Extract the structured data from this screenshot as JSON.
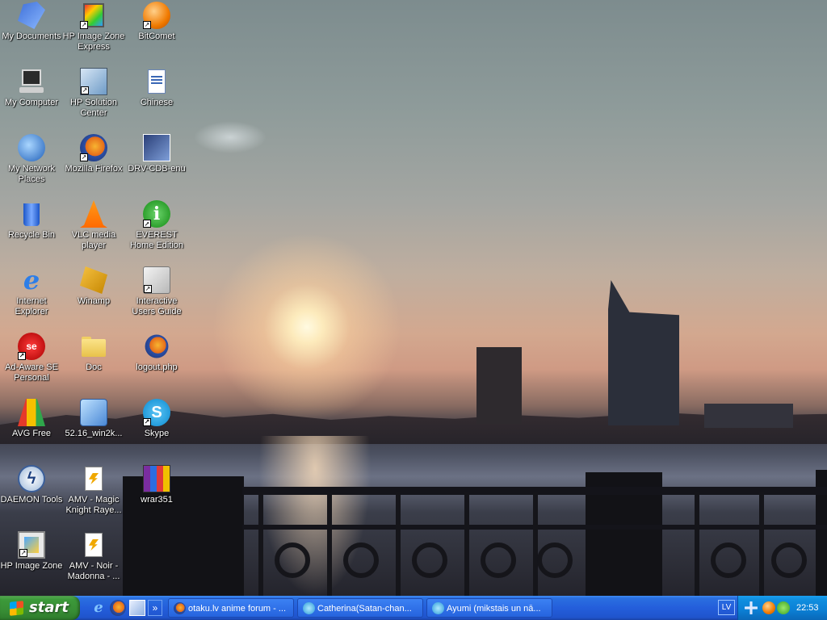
{
  "desktop": {
    "icons": [
      {
        "label": "My Documents"
      },
      {
        "label": "My Computer"
      },
      {
        "label": "My Network Places"
      },
      {
        "label": "Recycle Bin"
      },
      {
        "label": "Internet Explorer"
      },
      {
        "label": "Ad-Aware SE Personal"
      },
      {
        "label": "AVG Free"
      },
      {
        "label": "DAEMON Tools"
      },
      {
        "label": "HP  Image Zone"
      },
      {
        "label": "HP Image Zone Express"
      },
      {
        "label": "HP Solution Center"
      },
      {
        "label": "Mozilla Firefox"
      },
      {
        "label": "VLC media player"
      },
      {
        "label": "Winamp"
      },
      {
        "label": "Doc"
      },
      {
        "label": "52.16_win2k..."
      },
      {
        "label": "AMV - Magic Knight Raye..."
      },
      {
        "label": "AMV - Noir - Madonna - ..."
      },
      {
        "label": "BitComet"
      },
      {
        "label": "Chinese"
      },
      {
        "label": "DRV-CDB-enu"
      },
      {
        "label": "EVEREST Home Edition"
      },
      {
        "label": "Interactive Users Guide"
      },
      {
        "label": "logout.php"
      },
      {
        "label": "Skype"
      },
      {
        "label": "wrar351"
      }
    ]
  },
  "taskbar": {
    "start_label": "start",
    "quick_launch_more": "»",
    "tasks": [
      {
        "label": "otaku.lv anime forum - ..."
      },
      {
        "label": "Catherina(Satan-chan..."
      },
      {
        "label": "Ayumi (mikstais un nā..."
      }
    ],
    "language": "LV",
    "clock": "22:53"
  }
}
